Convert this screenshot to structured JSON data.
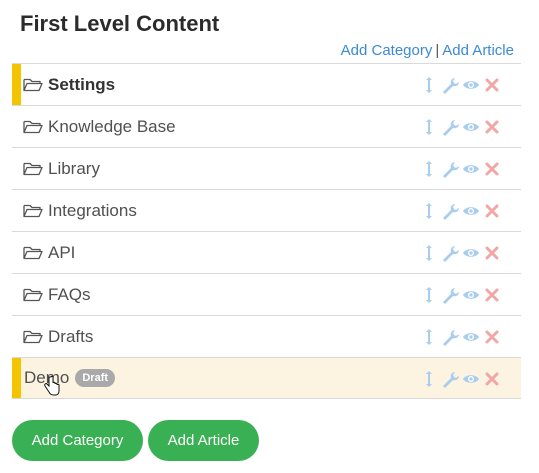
{
  "header": {
    "title": "First Level Content"
  },
  "top_links": {
    "add_category": "Add Category",
    "separator": "|",
    "add_article": "Add Article"
  },
  "rows": [
    {
      "label": "Settings",
      "bold": true,
      "marker": true,
      "folder": true
    },
    {
      "label": "Knowledge Base",
      "folder": true
    },
    {
      "label": "Library",
      "folder": true
    },
    {
      "label": "Integrations",
      "folder": true
    },
    {
      "label": "API",
      "folder": true
    },
    {
      "label": "FAQs",
      "folder": true
    },
    {
      "label": "Drafts",
      "folder": true
    },
    {
      "label": "Demo",
      "badge": "Draft",
      "marker": true,
      "highlighted": true,
      "folder": false
    }
  ],
  "row_actions": [
    "move-icon",
    "wrench-icon",
    "eye-icon",
    "delete-icon"
  ],
  "buttons": {
    "add_category": "Add Category",
    "add_article": "Add Article"
  },
  "colors": {
    "accent_green": "#3ab054",
    "link_blue": "#3a8ad4",
    "marker_yellow": "#f5c400",
    "action_blue": "#a9cdee",
    "delete_red": "#f2a7a7",
    "highlight_bg": "#fcf3e0"
  }
}
